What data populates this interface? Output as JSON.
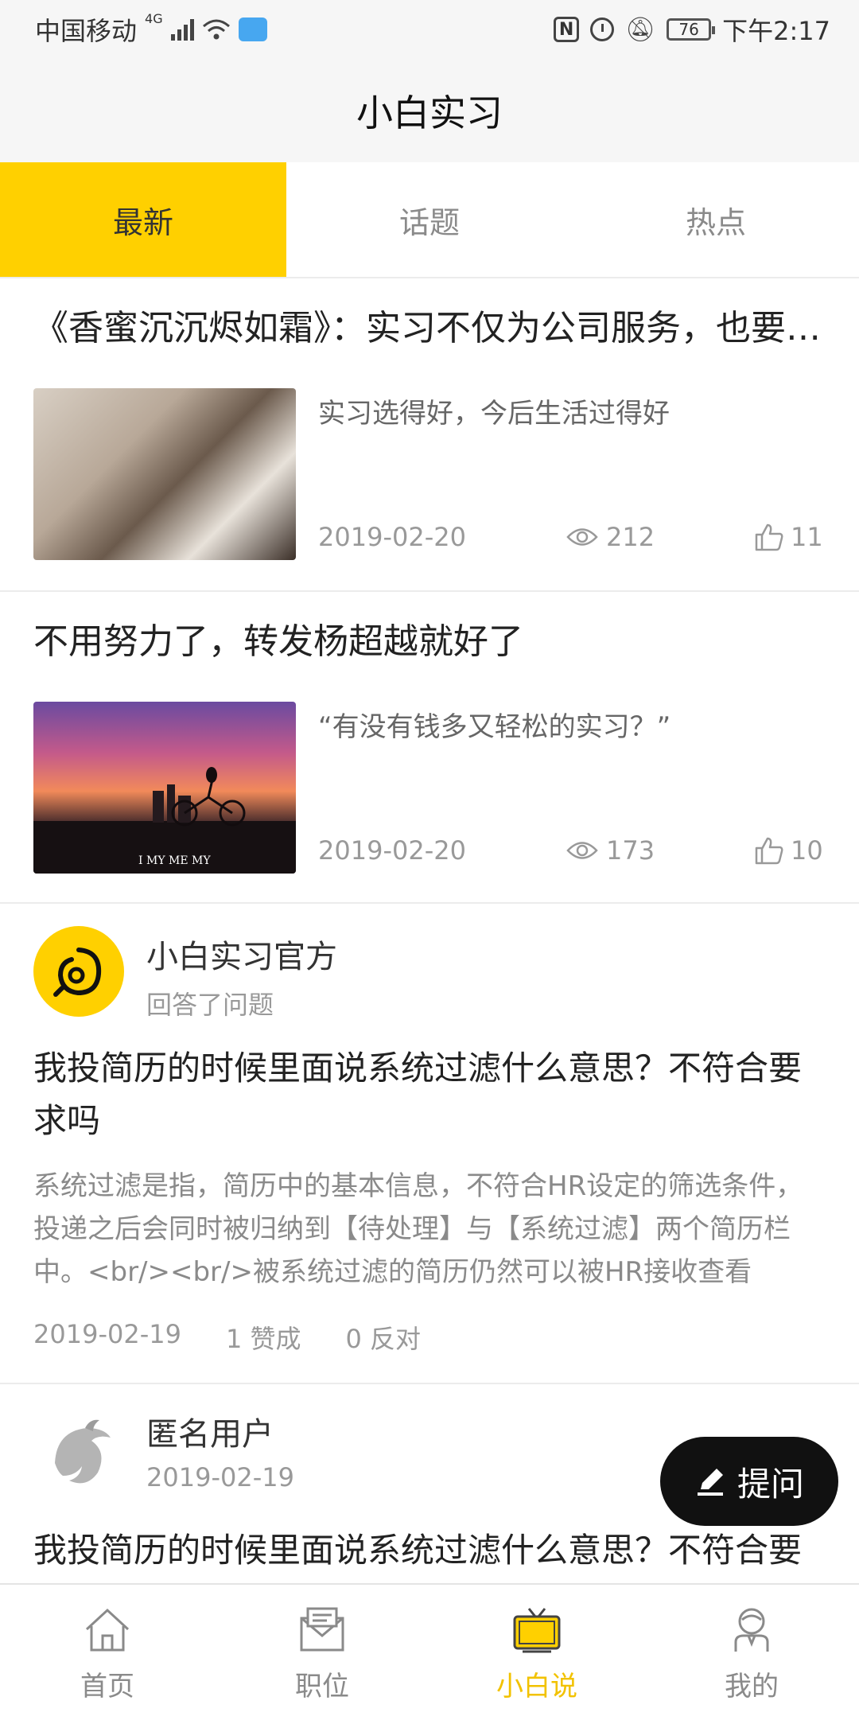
{
  "status_bar": {
    "carrier": "中国移动",
    "network": "4G",
    "battery": "76",
    "time": "下午2:17"
  },
  "header": {
    "title": "小白实习"
  },
  "tabs": [
    {
      "label": "最新",
      "active": true
    },
    {
      "label": "话题",
      "active": false
    },
    {
      "label": "热点",
      "active": false
    }
  ],
  "articles": [
    {
      "title": "《香蜜沉沉烬如霜》：实习不仅为公司服务，也要为自己发展",
      "summary": "实习选得好，今后生活过得好",
      "date": "2019-02-20",
      "views": "212",
      "likes": "11",
      "thumbnail_caption": ""
    },
    {
      "title": "不用努力了，转发杨超越就好了",
      "summary": "“有没有钱多又轻松的实习？”",
      "date": "2019-02-20",
      "views": "173",
      "likes": "10",
      "thumbnail_caption": "I MY ME MY"
    }
  ],
  "questions": [
    {
      "user": "小白实习官方",
      "action": "回答了问题",
      "title": "我投简历的时候里面说系统过滤什么意思？不符合要求吗",
      "answer": "系统过滤是指，简历中的基本信息，不符合HR设定的筛选条件，投递之后会同时被归纳到【待处理】与【系统过滤】两个简历栏中。<br/><br/>被系统过滤的简历仍然可以被HR接收查看",
      "date": "2019-02-19",
      "approve": "1 赞成",
      "oppose": "0 反对"
    },
    {
      "user": "匿名用户",
      "date": "2019-02-19",
      "title": "我投简历的时候里面说系统过滤什么意思？不符合要求吗"
    }
  ],
  "ask_button": {
    "label": "提问"
  },
  "bottom_nav": [
    {
      "label": "首页",
      "icon": "home-icon",
      "active": false
    },
    {
      "label": "职位",
      "icon": "job-icon",
      "active": false
    },
    {
      "label": "小白说",
      "icon": "tv-icon",
      "active": true
    },
    {
      "label": "我的",
      "icon": "profile-icon",
      "active": false
    }
  ],
  "colors": {
    "accent": "#ffd000",
    "nav_active": "#f2c200"
  }
}
